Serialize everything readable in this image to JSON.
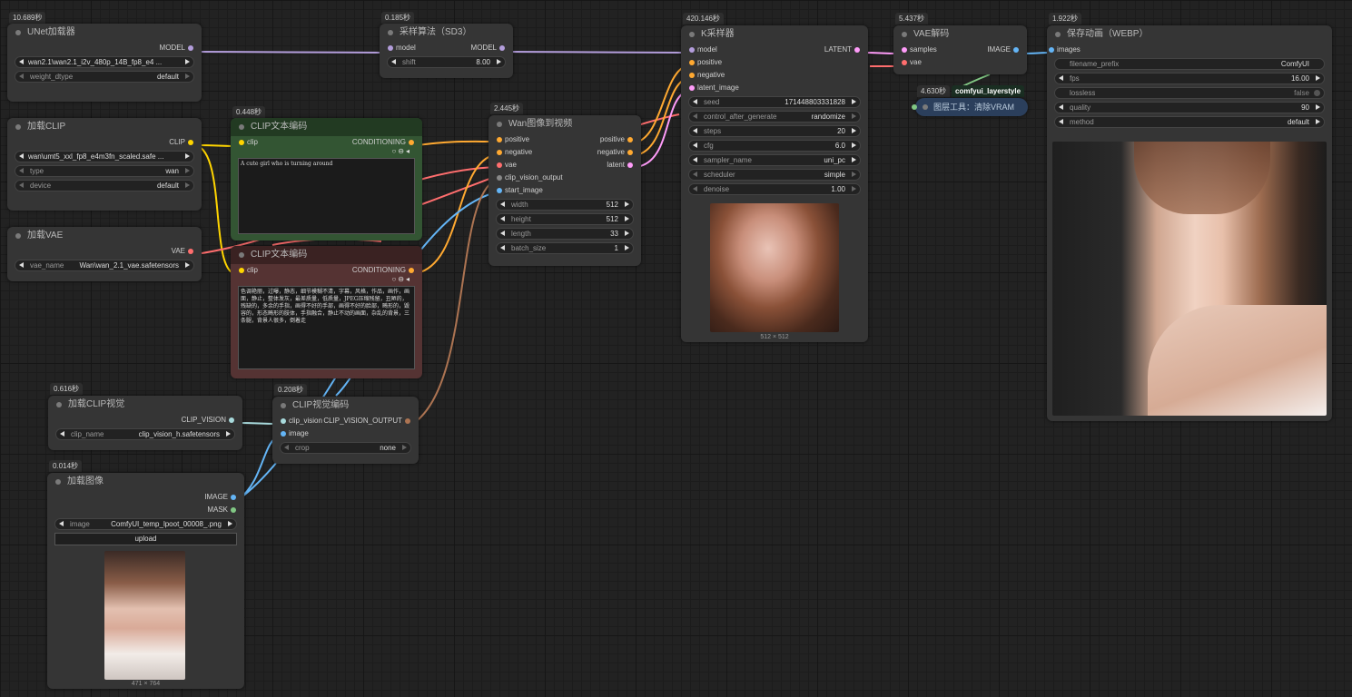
{
  "nodes": {
    "unet": {
      "time": "10.689秒",
      "title": "UNet加载器",
      "output": "MODEL",
      "widgets": [
        {
          "label": "",
          "value": "wan2.1\\wan2.1_i2v_480p_14B_fp8_e4 ..."
        },
        {
          "label": "weight_dtype",
          "value": "default"
        }
      ]
    },
    "sampling": {
      "time": "0.185秒",
      "title": "采样算法（SD3）",
      "input": "model",
      "output": "MODEL",
      "widgets": [
        {
          "label": "shift",
          "value": "8.00"
        }
      ]
    },
    "ksampler": {
      "time": "420.146秒",
      "title": "K采样器",
      "inputs": [
        "model",
        "positive",
        "negative",
        "latent_image"
      ],
      "output": "LATENT",
      "widgets": [
        {
          "label": "seed",
          "value": "171448803331828"
        },
        {
          "label": "control_after_generate",
          "value": "randomize"
        },
        {
          "label": "steps",
          "value": "20"
        },
        {
          "label": "cfg",
          "value": "6.0"
        },
        {
          "label": "sampler_name",
          "value": "uni_pc"
        },
        {
          "label": "scheduler",
          "value": "simple"
        },
        {
          "label": "denoise",
          "value": "1.00"
        }
      ],
      "caption": "512 × 512"
    },
    "vaedecode": {
      "time": "5.437秒",
      "title": "VAE解码",
      "inputs": [
        "samples",
        "vae"
      ],
      "output": "IMAGE"
    },
    "layerstyle": {
      "time": "4.630秒",
      "badge": "comfyui_layerstyle",
      "title": "图层工具：清除VRAM"
    },
    "save": {
      "time": "1.922秒",
      "title": "保存动画（WEBP）",
      "input": "images",
      "widgets": [
        {
          "label": "filename_prefix",
          "value": "ComfyUI"
        },
        {
          "label": "fps",
          "value": "16.00"
        },
        {
          "label": "lossless",
          "value": "false"
        },
        {
          "label": "quality",
          "value": "90"
        },
        {
          "label": "method",
          "value": "default"
        }
      ]
    },
    "clip": {
      "title": "加载CLIP",
      "output": "CLIP",
      "widgets": [
        {
          "label": "",
          "value": "wan\\umt5_xxl_fp8_e4m3fn_scaled.safe ..."
        },
        {
          "label": "type",
          "value": "wan"
        },
        {
          "label": "device",
          "value": "default"
        }
      ]
    },
    "vae": {
      "title": "加载VAE",
      "output": "VAE",
      "widgets": [
        {
          "label": "vae_name",
          "value": "Wan\\wan_2.1_vae.safetensors"
        }
      ]
    },
    "clipTextPos": {
      "time": "0.448秒",
      "title": "CLIP文本编码",
      "input": "clip",
      "output": "CONDITIONING",
      "text": "A cute girl who is turning around"
    },
    "clipTextNeg": {
      "title": "CLIP文本编码",
      "input": "clip",
      "output": "CONDITIONING",
      "text": "色调艳丽，过曝，静态，细节模糊不清，字幕，风格，作品，画作，画面，静止，整体发灰，最差质量，低质量，JPEG压缩残留，丑陋的，残缺的，多余的手指，画得不好的手部，画得不好的脸部，畸形的，毁容的，形态畸形的肢体，手指融合，静止不动的画面，杂乱的背景，三条腿，背景人很多，倒着走"
    },
    "wan": {
      "time": "2.445秒",
      "title": "Wan图像到视频",
      "inputs": [
        "positive",
        "negative",
        "vae",
        "clip_vision_output",
        "start_image"
      ],
      "outputs": [
        "positive",
        "negative",
        "latent"
      ],
      "widgets": [
        {
          "label": "width",
          "value": "512"
        },
        {
          "label": "height",
          "value": "512"
        },
        {
          "label": "length",
          "value": "33"
        },
        {
          "label": "batch_size",
          "value": "1"
        }
      ]
    },
    "clipVision": {
      "time": "0.616秒",
      "title": "加载CLIP视觉",
      "output": "CLIP_VISION",
      "widgets": [
        {
          "label": "clip_name",
          "value": "clip_vision_h.safetensors"
        }
      ]
    },
    "clipVisionEnc": {
      "time": "0.208秒",
      "title": "CLIP视觉编码",
      "inputs": [
        "clip_vision",
        "image"
      ],
      "output": "CLIP_VISION_OUTPUT",
      "widgets": [
        {
          "label": "crop",
          "value": "none"
        }
      ]
    },
    "loadImage": {
      "time": "0.014秒",
      "title": "加载图像",
      "outputs": [
        "IMAGE",
        "MASK"
      ],
      "widgets": [
        {
          "label": "image",
          "value": "ComfyUI_temp_lpoot_00008_.png"
        }
      ],
      "upload": "upload",
      "caption": "471 × 764"
    }
  },
  "colors": {
    "model": "#b39ddb",
    "clip": "#ffd500",
    "vae": "#ff6e6e",
    "conditioning": "#ffa931",
    "latent": "#ff9cf9",
    "image": "#64b5f6",
    "clip_vision": "#a8dadc",
    "clip_vision_output": "#ad7452",
    "mask": "#81c784"
  }
}
